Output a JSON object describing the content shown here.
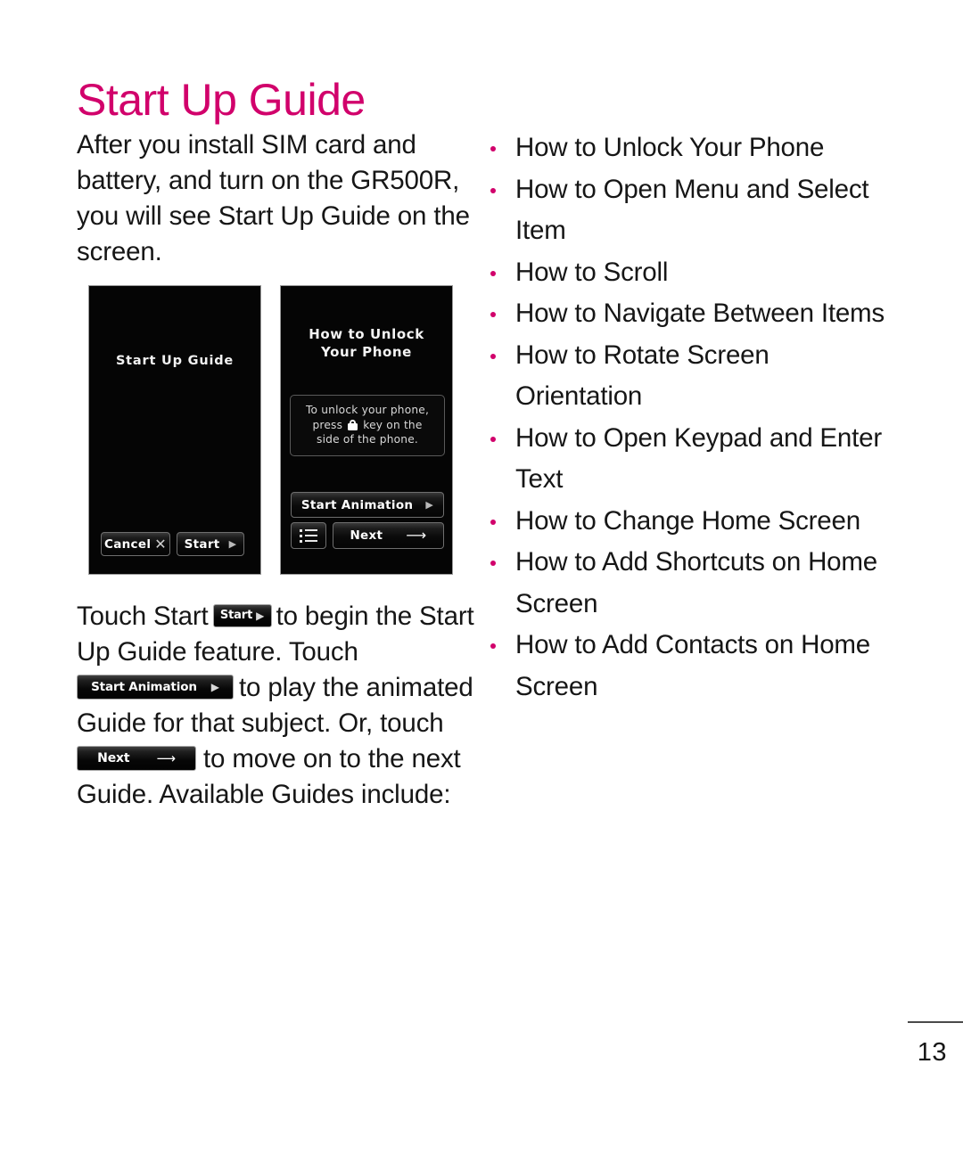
{
  "document": {
    "title": "Start Up Guide",
    "accent_color": "#d1006b",
    "text_color": "#161616",
    "page_number": "13"
  },
  "left_column": {
    "intro_paragraph": "After you install SIM card and battery, and turn on the GR500R, you will see Start Up Guide on the screen.",
    "instructions": {
      "part1": "Touch Start",
      "part2": "to begin the Start Up Guide feature. Touch",
      "part3": "to play the animated Guide for that subject. Or, touch",
      "part4": "to move on to the next Guide. Available Guides include:"
    },
    "inline_buttons": {
      "start": "Start",
      "start_animation": "Start Animation",
      "next": "Next"
    }
  },
  "screenshots": [
    {
      "name": "start-up-guide-screen",
      "title": "Start Up Guide",
      "buttons": [
        {
          "label": "Cancel",
          "icon": "close-icon"
        },
        {
          "label": "Start",
          "icon": "play-triangle-icon"
        }
      ]
    },
    {
      "name": "how-to-unlock-screen",
      "title_line1": "How to Unlock",
      "title_line2": "Your Phone",
      "info_line1": "To unlock your phone,",
      "info_line2_before": "press",
      "info_line2_after": "key on the",
      "info_line3": "side of the phone.",
      "info_icon": "lock-icon",
      "buttons": [
        {
          "label": "Start Animation",
          "icon": "play-triangle-icon"
        },
        {
          "label": "",
          "icon": "list-menu-icon"
        },
        {
          "label": "Next",
          "icon": "arrow-right-icon"
        }
      ]
    }
  ],
  "guides_list": [
    "How to Unlock Your Phone",
    "How to Open Menu and Select Item",
    "How to Scroll",
    "How to Navigate Between Items",
    "How to Rotate Screen Orientation",
    "How to Open Keypad and Enter Text",
    "How to Change Home Screen",
    "How to Add Shortcuts on Home Screen",
    "How to Add Contacts on Home Screen"
  ]
}
